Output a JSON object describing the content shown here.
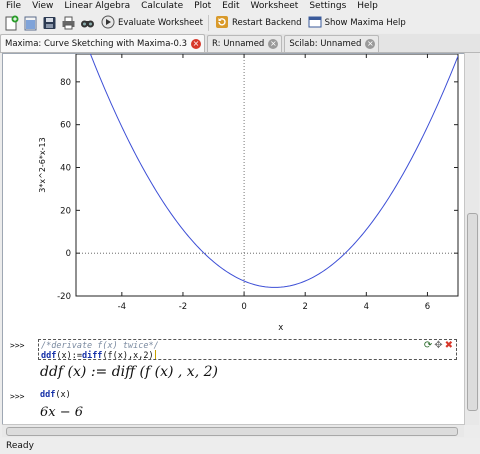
{
  "menu": [
    "File",
    "View",
    "Linear Algebra",
    "Calculate",
    "Plot",
    "Edit",
    "Worksheet",
    "Settings",
    "Help"
  ],
  "toolbar": {
    "evaluate_label": "Evaluate Worksheet",
    "restart_label": "Restart Backend",
    "help_label": "Show Maxima Help"
  },
  "tabs": [
    {
      "label": "Maxima: Curve Sketching with Maxima-0.3",
      "active": true
    },
    {
      "label": "R: Unnamed",
      "active": false
    },
    {
      "label": "Scilab: Unnamed",
      "active": false
    }
  ],
  "plot": {
    "ylabel": "3*x^2-6*x-13",
    "xlabel": "x",
    "y_ticks": [
      "80",
      "60",
      "40",
      "20",
      "0",
      "-20"
    ],
    "x_ticks": [
      "-4",
      "-2",
      "0",
      "2",
      "4",
      "6"
    ]
  },
  "chart_data": {
    "type": "line",
    "function": "3*x^2-6*x-13",
    "xlabel": "x",
    "ylabel": "3*x^2-6*x-13",
    "xlim": [
      -5.5,
      7
    ],
    "ylim": [
      -20,
      93
    ],
    "x_ticks": [
      -4,
      -2,
      0,
      2,
      4,
      6
    ],
    "y_ticks": [
      -20,
      0,
      20,
      40,
      60,
      80
    ],
    "series": [
      {
        "color": "#3d4fd6"
      }
    ]
  },
  "cells": {
    "prompt1": ">>>",
    "comment": "/*derivate f(x) twice*/",
    "code1_fn": "ddf",
    "code1_mid": "(x):=",
    "code1_diff": "diff",
    "code1_end": "(f(x),x,2)",
    "output1": "ddf (x) := diff (f (x) , x, 2)",
    "prompt2": ">>>",
    "code2_fn": "ddf",
    "code2_end": "(x)",
    "output2": "6x − 6"
  },
  "status": "Ready"
}
